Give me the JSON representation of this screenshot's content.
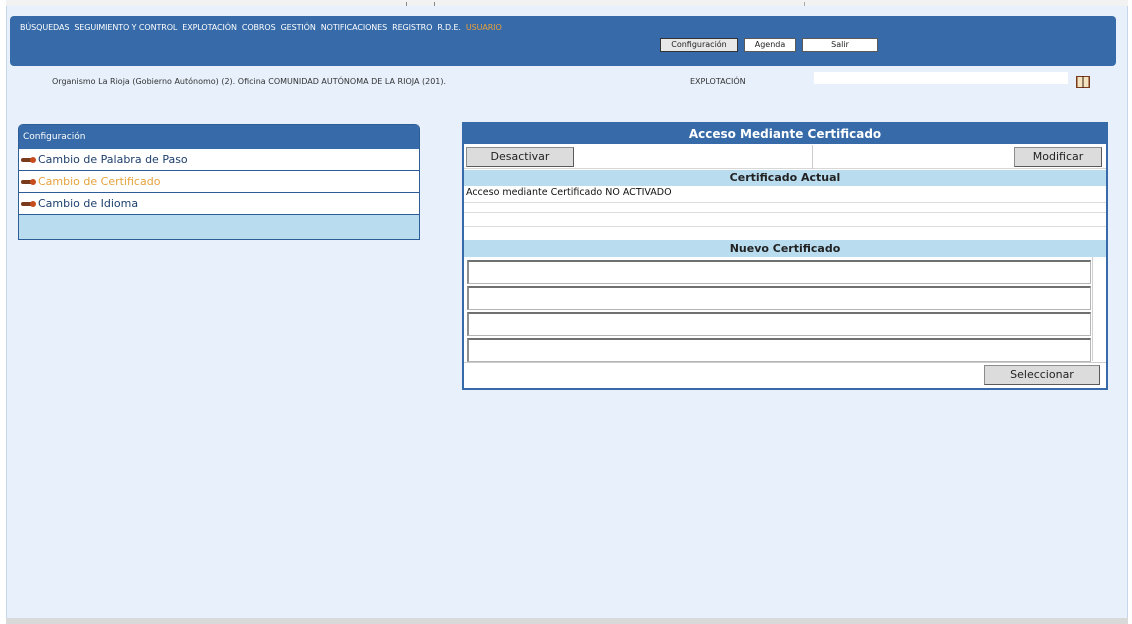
{
  "menu": {
    "items": [
      {
        "label": "BÚSQUEDAS"
      },
      {
        "label": "SEGUIMIENTO Y CONTROL"
      },
      {
        "label": "EXPLOTACIÓN"
      },
      {
        "label": "COBROS"
      },
      {
        "label": "GESTIÓN"
      },
      {
        "label": "NOTIFICACIONES"
      },
      {
        "label": "REGISTRO"
      },
      {
        "label": "R.D.E."
      },
      {
        "label": "USUARIO"
      }
    ],
    "active_index": 8,
    "active_color": "#e6a23c"
  },
  "user_submenu": {
    "configuracion": "Configuración",
    "agenda": "Agenda",
    "salir": "Salir"
  },
  "info": {
    "organismo": "Organismo La Rioja (Gobierno Autónomo) (2). Oficina COMUNIDAD AUTÓNOMA DE LA RIOJA (201).",
    "section": "EXPLOTACIÓN",
    "search_value": ""
  },
  "icons": {
    "book": "book-icon",
    "bullet": "arrow-bullet-icon"
  },
  "left_panel": {
    "title": "Configuración",
    "items": [
      {
        "label": "Cambio de Palabra de Paso"
      },
      {
        "label": "Cambio de Certificado"
      },
      {
        "label": "Cambio de Idioma"
      }
    ],
    "current_index": 1
  },
  "right_panel": {
    "title": "Acceso Mediante Certificado",
    "desactivar": "Desactivar",
    "modificar": "Modificar",
    "current_header": "Certificado Actual",
    "current_status": "Acceso mediante Certificado NO ACTIVADO",
    "new_header": "Nuevo Certificado",
    "fields": [
      "",
      "",
      "",
      ""
    ],
    "seleccionar": "Seleccionar"
  },
  "colors": {
    "header_blue": "#366aa8",
    "light_blue": "#b9dcef",
    "page_bg": "#e7f0fb",
    "accent_orange": "#e6a23c"
  }
}
